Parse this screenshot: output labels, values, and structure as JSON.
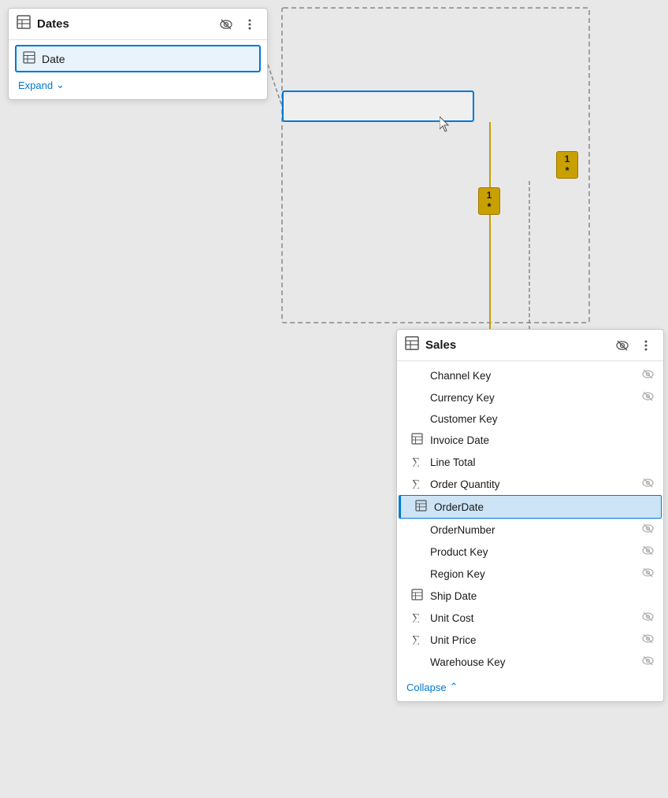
{
  "dates_card": {
    "title": "Dates",
    "row": {
      "label": "Date",
      "icon": "table-icon"
    },
    "expand_label": "Expand",
    "header_icons": {
      "eye": "👁",
      "more": "⋮"
    }
  },
  "sales_card": {
    "title": "Sales",
    "fields": [
      {
        "label": "Channel Key",
        "icon": "",
        "has_eye": true,
        "selected": false,
        "type": "none"
      },
      {
        "label": "Currency Key",
        "icon": "",
        "has_eye": true,
        "selected": false,
        "type": "none"
      },
      {
        "label": "Customer Key",
        "icon": "",
        "has_eye": false,
        "selected": false,
        "type": "none"
      },
      {
        "label": "Invoice Date",
        "icon": "table",
        "has_eye": false,
        "selected": false,
        "type": "table"
      },
      {
        "label": "Line Total",
        "icon": "sigma",
        "has_eye": false,
        "selected": false,
        "type": "sigma"
      },
      {
        "label": "Order Quantity",
        "icon": "sigma",
        "has_eye": true,
        "selected": false,
        "type": "sigma"
      },
      {
        "label": "OrderDate",
        "icon": "table",
        "has_eye": false,
        "selected": true,
        "type": "table"
      },
      {
        "label": "OrderNumber",
        "icon": "",
        "has_eye": true,
        "selected": false,
        "type": "none"
      },
      {
        "label": "Product Key",
        "icon": "",
        "has_eye": true,
        "selected": false,
        "type": "none"
      },
      {
        "label": "Region Key",
        "icon": "",
        "has_eye": true,
        "selected": false,
        "type": "none"
      },
      {
        "label": "Ship Date",
        "icon": "table",
        "has_eye": false,
        "selected": false,
        "type": "table"
      },
      {
        "label": "Unit Cost",
        "icon": "sigma",
        "has_eye": true,
        "selected": false,
        "type": "sigma"
      },
      {
        "label": "Unit Price",
        "icon": "sigma",
        "has_eye": true,
        "selected": false,
        "type": "sigma"
      },
      {
        "label": "Warehouse Key",
        "icon": "",
        "has_eye": true,
        "selected": false,
        "type": "none"
      }
    ],
    "collapse_label": "Collapse",
    "header_icons": {
      "eye": "👁",
      "more": "⋮"
    }
  },
  "rel_markers": {
    "one_star_1": {
      "num": "1",
      "sym": "*"
    },
    "one_star_2": {
      "num": "1",
      "sym": "*"
    }
  },
  "icons": {
    "table_unicode": "⊞",
    "sigma_unicode": "∑",
    "eye_hidden": "👁",
    "chevron_down": "∨",
    "chevron_up": "∧",
    "more_vert": "⋮"
  }
}
